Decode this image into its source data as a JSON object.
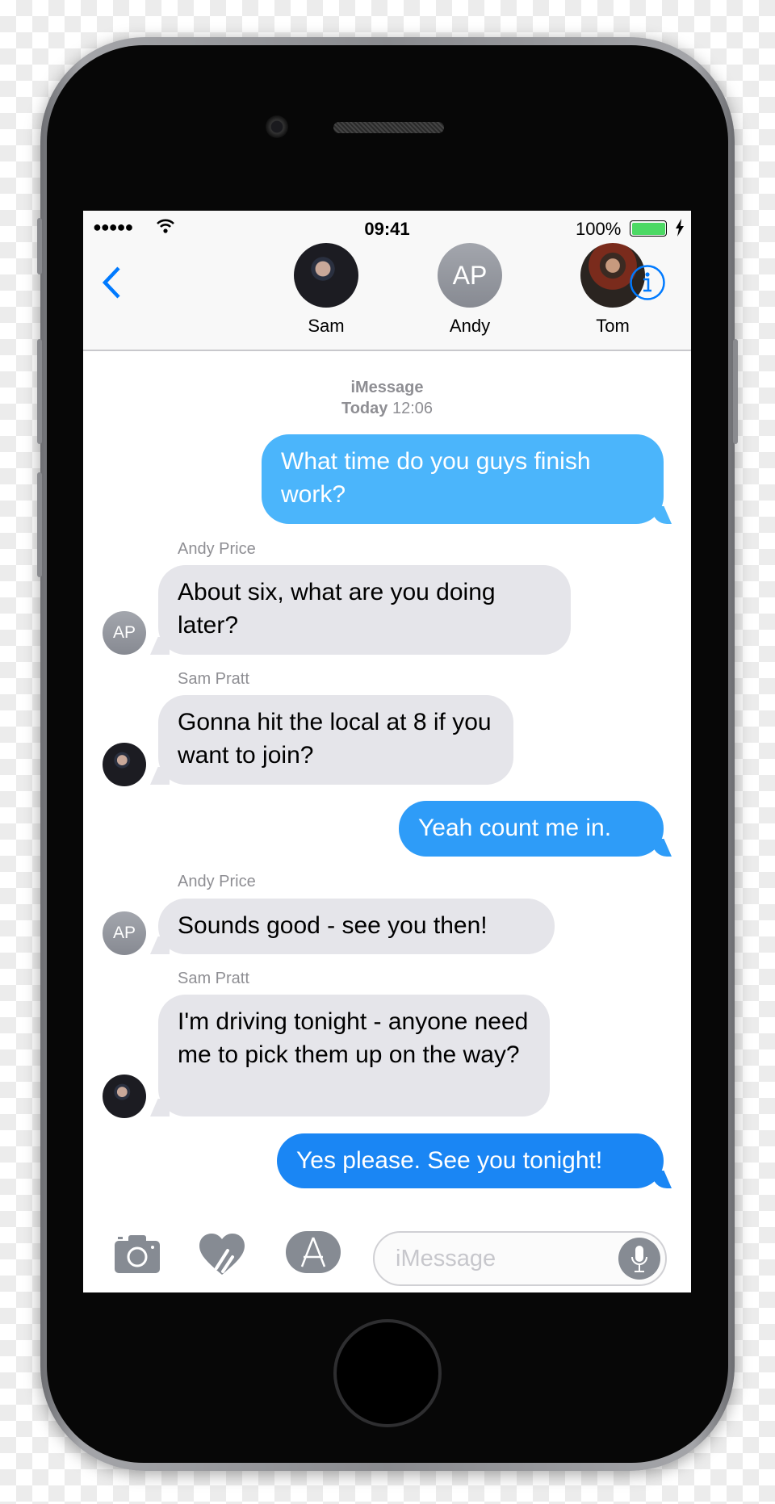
{
  "status_bar": {
    "signal": "●●●●●",
    "time": "09:41",
    "battery": "100%",
    "battery_level": 1.0,
    "battery_color": "#4cd964"
  },
  "header": {
    "back_icon": "chevron-left-icon",
    "info_icon": "info-icon",
    "contacts": [
      {
        "name": "Sam",
        "avatar": "photo"
      },
      {
        "name": "Andy",
        "initials": "AP"
      },
      {
        "name": "Tom",
        "avatar": "photo"
      }
    ],
    "accent": "#007aff"
  },
  "conversation": {
    "service": "iMessage",
    "day": "Today",
    "time": "12:06",
    "messages": [
      {
        "direction": "out",
        "text": "What time do you guys finish work?",
        "color": "#4bb5fb"
      },
      {
        "direction": "in",
        "sender": "Andy Price",
        "avatar_initials": "AP",
        "text": "About six, what are you doing later?"
      },
      {
        "direction": "in",
        "sender": "Sam Pratt",
        "text": "Gonna hit the local at 8 if you want to join?"
      },
      {
        "direction": "out",
        "text": "Yeah count me in.",
        "color": "#2e9cf8"
      },
      {
        "direction": "in",
        "sender": "Andy Price",
        "avatar_initials": "AP",
        "text": "Sounds good - see you then!"
      },
      {
        "direction": "in",
        "sender": "Sam Pratt",
        "text": "I'm driving tonight - anyone need me to pick them up on the way?"
      },
      {
        "direction": "out",
        "text": "Yes please. See you tonight!",
        "color": "#1a86f4"
      }
    ]
  },
  "composer": {
    "placeholder": "iMessage",
    "camera_icon": "camera-icon",
    "digital_touch_icon": "heart-touch-icon",
    "app_store_icon": "app-store-icon",
    "mic_icon": "microphone-icon"
  }
}
